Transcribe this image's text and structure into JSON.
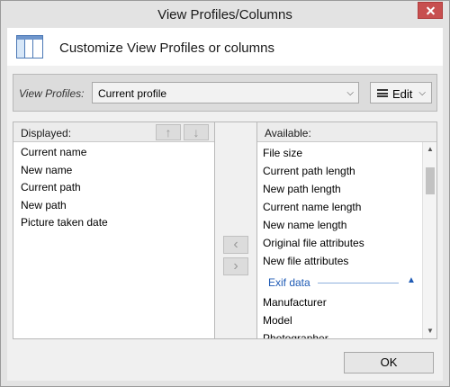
{
  "window": {
    "title": "View Profiles/Columns"
  },
  "header": {
    "text": "Customize View Profiles or columns"
  },
  "profiles": {
    "label": "View Profiles:",
    "selected": "Current profile",
    "edit_label": "Edit"
  },
  "displayed": {
    "header": "Displayed:",
    "items": [
      "Current name",
      "New name",
      "Current path",
      "New path",
      "Picture taken date"
    ]
  },
  "available": {
    "header": "Available:",
    "items_top": [
      "File size",
      "Current path length",
      "New path length",
      "Current name length",
      "New name length",
      "Original file attributes",
      "New file attributes"
    ],
    "group_label": "Exif data",
    "items_bottom": [
      "Manufacturer",
      "Model",
      "Photographer"
    ]
  },
  "icons": {
    "close": "close-icon",
    "columns": "columns-icon",
    "menu": "hamburger-icon",
    "chevron": "chevron-down-icon",
    "up": "arrow-up-icon",
    "down": "arrow-down-icon",
    "left": "chevron-left-icon",
    "right": "chevron-right-icon"
  },
  "footer": {
    "ok_label": "OK"
  }
}
